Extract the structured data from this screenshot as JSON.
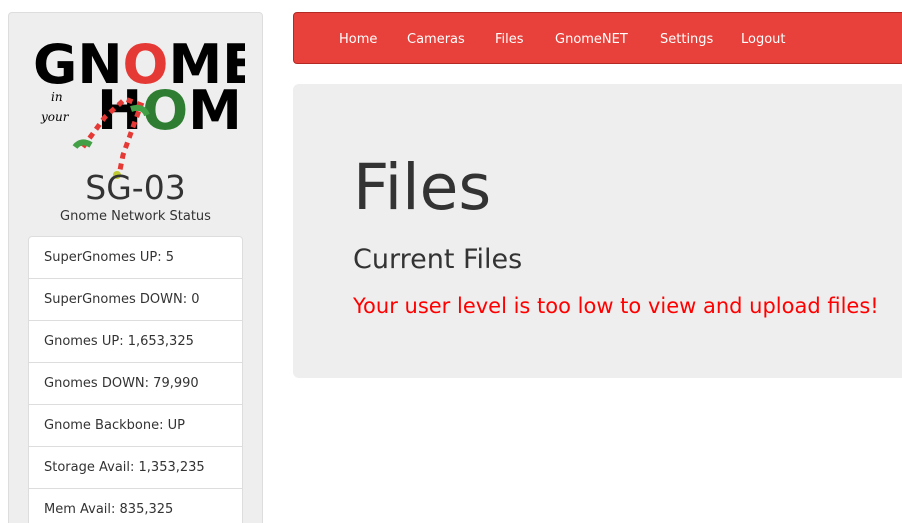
{
  "logo": {
    "word1": "GNOME",
    "word_in": "in",
    "word_your": "your",
    "word2": "HOME"
  },
  "sidebar": {
    "title": "SG-03",
    "status_title": "Gnome Network Status",
    "stats": [
      "SuperGnomes UP: 5",
      "SuperGnomes DOWN: 0",
      "Gnomes UP: 1,653,325",
      "Gnomes DOWN: 79,990",
      "Gnome Backbone: UP",
      "Storage Avail: 1,353,235",
      "Mem Avail: 835,325"
    ]
  },
  "navbar": {
    "items": [
      "Home",
      "Cameras",
      "Files",
      "GnomeNET",
      "Settings",
      "Logout"
    ],
    "color": "#e8403a"
  },
  "main": {
    "heading": "Files",
    "subheading": "Current Files",
    "error": "Your user level is too low to view and upload files!",
    "error_color": "#ff0000"
  }
}
